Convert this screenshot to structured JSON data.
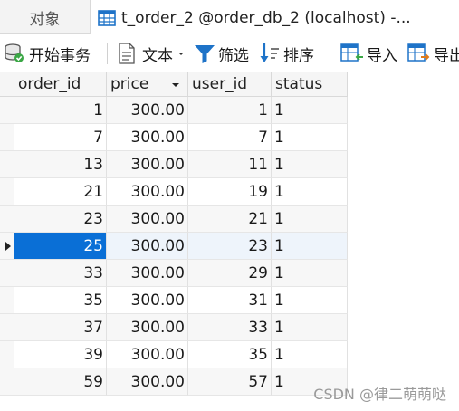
{
  "tabs": {
    "objects_label": "对象",
    "active_title": "t_order_2 @order_db_2 (localhost) -..."
  },
  "toolbar": {
    "begin_transaction": "开始事务",
    "text": "文本",
    "filter": "筛选",
    "sort": "排序",
    "import": "导入",
    "export": "导出"
  },
  "grid": {
    "columns": [
      "order_id",
      "price",
      "user_id",
      "status"
    ],
    "sorted_column": "price",
    "selected_row_index": 5,
    "rows": [
      {
        "order_id": "1",
        "price": "300.00",
        "user_id": "1",
        "status": "1"
      },
      {
        "order_id": "7",
        "price": "300.00",
        "user_id": "7",
        "status": "1"
      },
      {
        "order_id": "13",
        "price": "300.00",
        "user_id": "11",
        "status": "1"
      },
      {
        "order_id": "21",
        "price": "300.00",
        "user_id": "19",
        "status": "1"
      },
      {
        "order_id": "23",
        "price": "300.00",
        "user_id": "21",
        "status": "1"
      },
      {
        "order_id": "25",
        "price": "300.00",
        "user_id": "23",
        "status": "1"
      },
      {
        "order_id": "33",
        "price": "300.00",
        "user_id": "29",
        "status": "1"
      },
      {
        "order_id": "35",
        "price": "300.00",
        "user_id": "31",
        "status": "1"
      },
      {
        "order_id": "37",
        "price": "300.00",
        "user_id": "33",
        "status": "1"
      },
      {
        "order_id": "39",
        "price": "300.00",
        "user_id": "35",
        "status": "1"
      },
      {
        "order_id": "59",
        "price": "300.00",
        "user_id": "57",
        "status": "1"
      }
    ]
  },
  "watermark": "CSDN @律二萌萌哒",
  "colors": {
    "selection": "#0a6fd6",
    "icon_blue": "#1e73c8"
  }
}
